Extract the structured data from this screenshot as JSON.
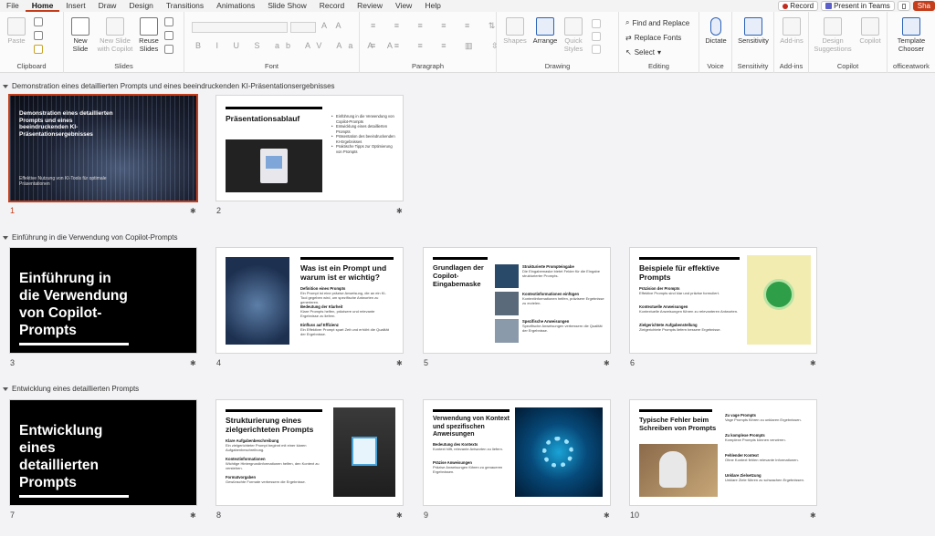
{
  "menu": {
    "tabs": [
      "File",
      "Home",
      "Insert",
      "Draw",
      "Design",
      "Transitions",
      "Animations",
      "Slide Show",
      "Record",
      "Review",
      "View",
      "Help"
    ],
    "record": "Record",
    "present": "Present in Teams",
    "share": "Sha"
  },
  "ribbon": {
    "clipboard": {
      "label": "Clipboard",
      "paste": "Paste"
    },
    "slides": {
      "label": "Slides",
      "new_slide": "New Slide",
      "new_slide_copilot": "New Slide with Copilot",
      "reuse_slides": "Reuse Slides"
    },
    "font": {
      "label": "Font"
    },
    "paragraph": {
      "label": "Paragraph"
    },
    "drawing": {
      "label": "Drawing",
      "shapes": "Shapes",
      "arrange": "Arrange",
      "quick_styles": "Quick Styles"
    },
    "editing": {
      "label": "Editing",
      "find_replace": "Find and Replace",
      "replace_fonts": "Replace Fonts",
      "select": "Select"
    },
    "voice": {
      "label": "Voice",
      "dictate": "Dictate"
    },
    "sensitivity": {
      "label": "Sensitivity",
      "sensitivity": "Sensitivity"
    },
    "addins": {
      "label": "Add-ins",
      "addins": "Add-ins"
    },
    "copilot": {
      "label": "Copilot",
      "design_suggestions": "Design Suggestions",
      "copilot": "Copilot"
    },
    "officeatwork": {
      "label": "officeatwork",
      "template_chooser": "Template Chooser"
    }
  },
  "sections": [
    {
      "title": "Demonstration eines detaillierten Prompts und eines beeindruckenden KI-Präsentationsergebnisses"
    },
    {
      "title": "Einführung in die Verwendung von Copilot-Prompts"
    },
    {
      "title": "Entwicklung eines detaillierten Prompts"
    }
  ],
  "slides": [
    {
      "num": "1",
      "title": "Demonstration eines detaillierten Prompts und eines beeindruckenden KI-Präsentationsergebnisses",
      "subtitle": "Effektive Nutzung von KI-Tools für optimale Präsentationen"
    },
    {
      "num": "2",
      "title": "Präsentationsablauf",
      "bullets": [
        "Einführung in die Verwendung von Copilot-Prompts",
        "Entwicklung eines detaillierten Prompts",
        "Präsentation des beeindruckenden KI-Ergebnisses",
        "Praktische Tipps zur Optimierung von Prompts"
      ]
    },
    {
      "num": "3",
      "title": "Einführung in die Verwendung von Copilot-Prompts"
    },
    {
      "num": "4",
      "title": "Was ist ein Prompt und warum ist er wichtig?",
      "blocks": [
        {
          "h": "Definition eines Prompts",
          "t": "Ein Prompt ist eine präzise Anweisung, die an ein KI-Tool gegeben wird, um spezifische Antworten zu generieren."
        },
        {
          "h": "Bedeutung der Klarheit",
          "t": "Klare Prompts helfen, präzisere und relevante Ergebnisse zu liefern."
        },
        {
          "h": "Einfluss auf Effizienz",
          "t": "Ein Effektiver Prompt spart Zeit und erhöht die Qualität der Ergebnisse."
        }
      ]
    },
    {
      "num": "5",
      "title": "Grundlagen der Copilot-Eingabemaske",
      "blocks": [
        {
          "h": "Strukturierte Prompteingabe",
          "t": "Die Eingabemaske bietet Felder für die Eingabe strukturierter Prompts."
        },
        {
          "h": "Kontextinformationen einfügen",
          "t": "Kontextinformationen helfen, präzisere Ergebnisse zu erzielen."
        },
        {
          "h": "Spezifische Anweisungen",
          "t": "Spezifische Anweisungen verbessern die Qualität der Ergebnisse."
        }
      ]
    },
    {
      "num": "6",
      "title": "Beispiele für effektive Prompts",
      "blocks": [
        {
          "h": "Präzision der Prompts",
          "t": "Effektive Prompts sind klar und präzise formuliert."
        },
        {
          "h": "Kontextuelle Anweisungen",
          "t": "Kontextuelle Anweisungen führen zu relevanteren Antworten."
        },
        {
          "h": "Zielgerichtete Aufgabenstellung",
          "t": "Zielgerichtete Prompts liefern bessere Ergebnisse."
        }
      ]
    },
    {
      "num": "7",
      "title": "Entwicklung eines detaillierten Prompts"
    },
    {
      "num": "8",
      "title": "Strukturierung eines zielgerichteten Prompts",
      "blocks": [
        {
          "h": "Klare Aufgabenbeschreibung",
          "t": "Ein zielgerichteter Prompt beginnt mit einer klaren Aufgabenbeschreibung."
        },
        {
          "h": "Kontextinformationen",
          "t": "Wichtige Hintergrundinformationen helfen, den Kontext zu verstehen."
        },
        {
          "h": "Formatvorgaben",
          "t": "Gewünschte Formate verbessern die Ergebnisse."
        }
      ]
    },
    {
      "num": "9",
      "title": "Verwendung von Kontext und spezifischen Anweisungen",
      "blocks": [
        {
          "h": "Bedeutung des Kontexts",
          "t": "Kontext hilft, relevante Antworten zu liefern."
        },
        {
          "h": "Präzise Anweisungen",
          "t": "Präzise Anweisungen führen zu genaueren Ergebnissen."
        }
      ]
    },
    {
      "num": "10",
      "title": "Typische Fehler beim Schreiben von Prompts",
      "blocks": [
        {
          "h": "Zu vage Prompts",
          "t": "Vage Prompts führen zu unklaren Ergebnissen."
        },
        {
          "h": "Zu komplexe Prompts",
          "t": "Komplexe Prompts können verwirren."
        },
        {
          "h": "Fehlender Kontext",
          "t": "Ohne Kontext fehlen relevante Informationen."
        },
        {
          "h": "Unklare Zielsetzung",
          "t": "Unklare Ziele führen zu schwachen Ergebnissen."
        }
      ]
    }
  ]
}
